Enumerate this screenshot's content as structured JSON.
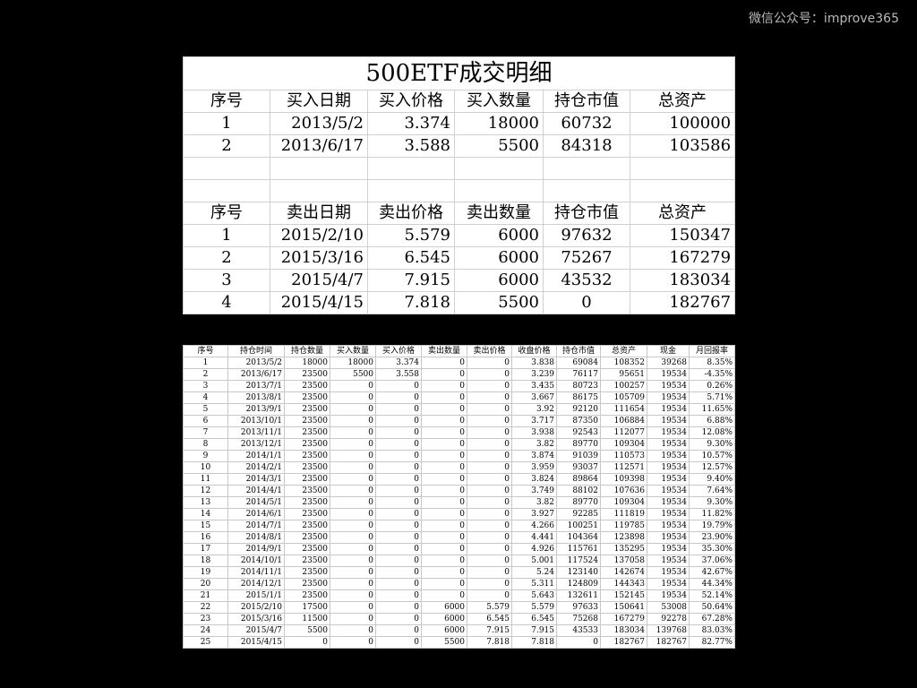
{
  "watermark": "微信公众号：improve365",
  "summary": {
    "title": "500ETF成交明细",
    "buy_headers": [
      "序号",
      "买入日期",
      "买入价格",
      "买入数量",
      "持仓市值",
      "总资产"
    ],
    "buy_rows": [
      [
        "1",
        "2013/5/2",
        "3.374",
        "18000",
        "60732",
        "100000"
      ],
      [
        "2",
        "2013/6/17",
        "3.588",
        "5500",
        "84318",
        "103586"
      ]
    ],
    "sell_headers": [
      "序号",
      "卖出日期",
      "卖出价格",
      "卖出数量",
      "持仓市值",
      "总资产"
    ],
    "sell_rows": [
      [
        "1",
        "2015/2/10",
        "5.579",
        "6000",
        "97632",
        "150347"
      ],
      [
        "2",
        "2015/3/16",
        "6.545",
        "6000",
        "75267",
        "167279"
      ],
      [
        "3",
        "2015/4/7",
        "7.915",
        "6000",
        "43532",
        "183034"
      ],
      [
        "4",
        "2015/4/15",
        "7.818",
        "5500",
        "0",
        "182767"
      ]
    ]
  },
  "monthly": {
    "headers": [
      "序号",
      "持仓时间",
      "持仓数量",
      "买入数量",
      "买入价格",
      "卖出数量",
      "卖出价格",
      "收盘价格",
      "持仓市值",
      "总资产",
      "现金",
      "月回报率"
    ],
    "rows": [
      [
        "1",
        "2013/5/2",
        "18000",
        "18000",
        "3.374",
        "0",
        "0",
        "3.838",
        "69084",
        "108352",
        "39268",
        "8.35%"
      ],
      [
        "2",
        "2013/6/17",
        "23500",
        "5500",
        "3.558",
        "0",
        "0",
        "3.239",
        "76117",
        "95651",
        "19534",
        "-4.35%"
      ],
      [
        "3",
        "2013/7/1",
        "23500",
        "0",
        "0",
        "0",
        "0",
        "3.435",
        "80723",
        "100257",
        "19534",
        "0.26%"
      ],
      [
        "4",
        "2013/8/1",
        "23500",
        "0",
        "0",
        "0",
        "0",
        "3.667",
        "86175",
        "105709",
        "19534",
        "5.71%"
      ],
      [
        "5",
        "2013/9/1",
        "23500",
        "0",
        "0",
        "0",
        "0",
        "3.92",
        "92120",
        "111654",
        "19534",
        "11.65%"
      ],
      [
        "6",
        "2013/10/1",
        "23500",
        "0",
        "0",
        "0",
        "0",
        "3.717",
        "87350",
        "106884",
        "19534",
        "6.88%"
      ],
      [
        "7",
        "2013/11/1",
        "23500",
        "0",
        "0",
        "0",
        "0",
        "3.938",
        "92543",
        "112077",
        "19534",
        "12.08%"
      ],
      [
        "8",
        "2013/12/1",
        "23500",
        "0",
        "0",
        "0",
        "0",
        "3.82",
        "89770",
        "109304",
        "19534",
        "9.30%"
      ],
      [
        "9",
        "2014/1/1",
        "23500",
        "0",
        "0",
        "0",
        "0",
        "3.874",
        "91039",
        "110573",
        "19534",
        "10.57%"
      ],
      [
        "10",
        "2014/2/1",
        "23500",
        "0",
        "0",
        "0",
        "0",
        "3.959",
        "93037",
        "112571",
        "19534",
        "12.57%"
      ],
      [
        "11",
        "2014/3/1",
        "23500",
        "0",
        "0",
        "0",
        "0",
        "3.824",
        "89864",
        "109398",
        "19534",
        "9.40%"
      ],
      [
        "12",
        "2014/4/1",
        "23500",
        "0",
        "0",
        "0",
        "0",
        "3.749",
        "88102",
        "107636",
        "19534",
        "7.64%"
      ],
      [
        "13",
        "2014/5/1",
        "23500",
        "0",
        "0",
        "0",
        "0",
        "3.82",
        "89770",
        "109304",
        "19534",
        "9.30%"
      ],
      [
        "14",
        "2014/6/1",
        "23500",
        "0",
        "0",
        "0",
        "0",
        "3.927",
        "92285",
        "111819",
        "19534",
        "11.82%"
      ],
      [
        "15",
        "2014/7/1",
        "23500",
        "0",
        "0",
        "0",
        "0",
        "4.266",
        "100251",
        "119785",
        "19534",
        "19.79%"
      ],
      [
        "16",
        "2014/8/1",
        "23500",
        "0",
        "0",
        "0",
        "0",
        "4.441",
        "104364",
        "123898",
        "19534",
        "23.90%"
      ],
      [
        "17",
        "2014/9/1",
        "23500",
        "0",
        "0",
        "0",
        "0",
        "4.926",
        "115761",
        "135295",
        "19534",
        "35.30%"
      ],
      [
        "18",
        "2014/10/1",
        "23500",
        "0",
        "0",
        "0",
        "0",
        "5.001",
        "117524",
        "137058",
        "19534",
        "37.06%"
      ],
      [
        "19",
        "2014/11/1",
        "23500",
        "0",
        "0",
        "0",
        "0",
        "5.24",
        "123140",
        "142674",
        "19534",
        "42.67%"
      ],
      [
        "20",
        "2014/12/1",
        "23500",
        "0",
        "0",
        "0",
        "0",
        "5.311",
        "124809",
        "144343",
        "19534",
        "44.34%"
      ],
      [
        "21",
        "2015/1/1",
        "23500",
        "0",
        "0",
        "0",
        "0",
        "5.643",
        "132611",
        "152145",
        "19534",
        "52.14%"
      ],
      [
        "22",
        "2015/2/10",
        "17500",
        "0",
        "0",
        "6000",
        "5.579",
        "5.579",
        "97633",
        "150641",
        "53008",
        "50.64%"
      ],
      [
        "23",
        "2015/3/16",
        "11500",
        "0",
        "0",
        "6000",
        "6.545",
        "6.545",
        "75268",
        "167279",
        "92278",
        "67.28%"
      ],
      [
        "24",
        "2015/4/7",
        "5500",
        "0",
        "0",
        "6000",
        "7.915",
        "7.915",
        "43533",
        "183034",
        "139768",
        "83.03%"
      ],
      [
        "25",
        "2015/4/15",
        "0",
        "0",
        "0",
        "5500",
        "7.818",
        "7.818",
        "0",
        "182767",
        "182767",
        "82.77%"
      ]
    ]
  }
}
